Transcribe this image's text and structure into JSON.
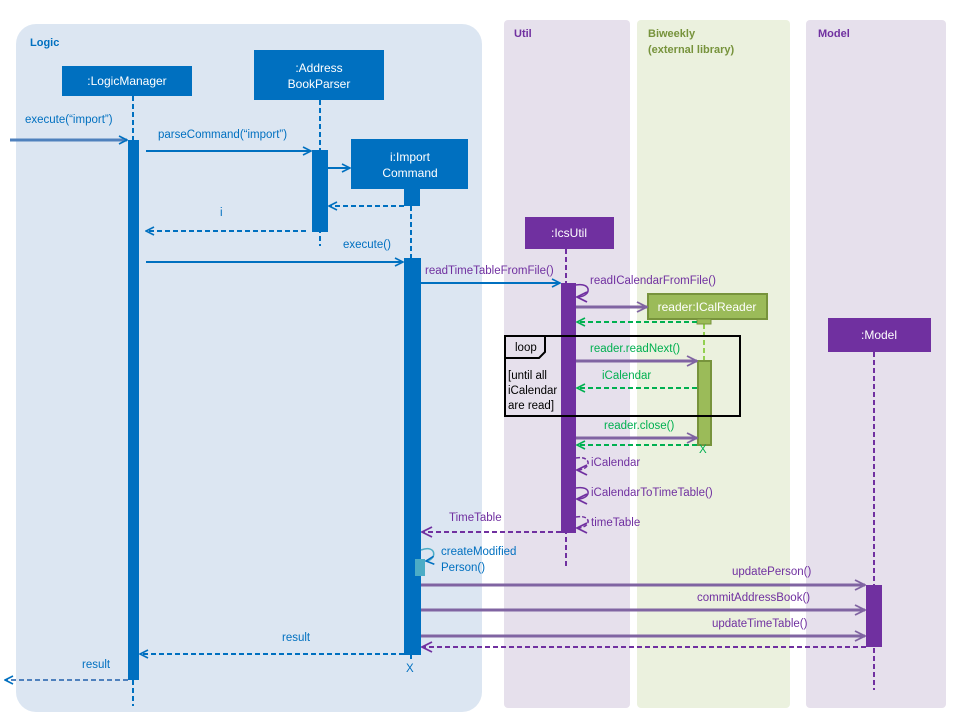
{
  "colors": {
    "logic_bg": "#dce6f2",
    "logic": "#0070c0",
    "util_bg": "#e6e0ec",
    "util": "#7030a0",
    "biweekly_bg": "#ebf1de",
    "biweekly": "#9bbb59",
    "biweekly_text": "#77933c",
    "return_green": "#00b050"
  },
  "frames": {
    "logic": "Logic",
    "util": "Util",
    "biweekly": [
      "Biweekly",
      "(external library)"
    ],
    "model": "Model"
  },
  "participants": {
    "logic_manager": ":LogicManager",
    "parser": [
      ":Address",
      "BookParser"
    ],
    "import_command": [
      "i:Import",
      "Command"
    ],
    "ics_util": ":IcsUtil",
    "ical_reader": "reader:ICalReader",
    "model": ":Model"
  },
  "messages": {
    "execute_import": "execute(“import”)",
    "parse_command": "parseCommand(“import”)",
    "return_i": "i",
    "execute": "execute()",
    "read_timetable": "readTimeTableFromFile()",
    "read_icalendar": "readICalendarFromFile()",
    "read_next": "reader.readNext()",
    "icalendar_return": "iCalendar",
    "close": "reader.close()",
    "icalendar_self": "iCalendar",
    "to_timetable": "iCalendarToTimeTable()",
    "timetable_self": "timeTable",
    "timetable_return": "TimeTable",
    "create_modified": [
      "createModified",
      "Person()"
    ],
    "update_person": "updatePerson()",
    "commit": "commitAddressBook()",
    "update_timetable": "updateTimeTable()",
    "result_inner": "result",
    "result_outer": "result",
    "destroy_mark": "X"
  },
  "loop": {
    "label": "loop",
    "guard": [
      "[until all",
      "iCalendar",
      "are read]"
    ]
  }
}
